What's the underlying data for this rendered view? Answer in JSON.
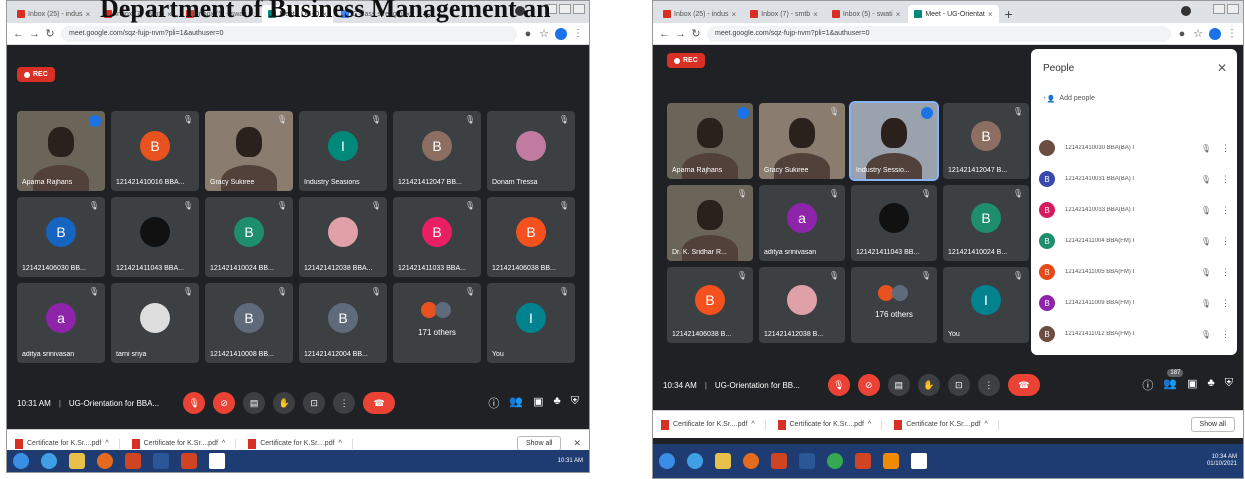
{
  "heading": "Department of Business Management an",
  "left": {
    "tabs": [
      {
        "label": "Inbox (25) - indus",
        "active": false,
        "kind": "gmail"
      },
      {
        "label": "Inbox (7) - smtb",
        "active": false,
        "kind": "gmail"
      },
      {
        "label": "Inbox (5) - swati",
        "active": false,
        "kind": "gmail"
      },
      {
        "label": "Meet - UG-O",
        "active": true,
        "kind": "meet"
      },
      {
        "label": "G class strength",
        "active": false,
        "kind": "gmail"
      }
    ],
    "url": "meet.google.com/sqz-fujp-nvm?pli=1&authuser=0",
    "rec_label": "REC",
    "tiles": [
      {
        "name": "Aparna Rajhans",
        "type": "photo",
        "initial": "",
        "color": "",
        "speaking": true
      },
      {
        "name": "121421410016 BBA...",
        "type": "initial",
        "initial": "B",
        "color": "#e8521f"
      },
      {
        "name": "Gracy Sukiree",
        "type": "photo2",
        "initial": "",
        "color": ""
      },
      {
        "name": "Industry Seasions",
        "type": "initial",
        "initial": "I",
        "color": "#00897b"
      },
      {
        "name": "121421412047 BB...",
        "type": "initial",
        "initial": "B",
        "color": "#8d6e63"
      },
      {
        "name": "Donam Tressa",
        "type": "pic",
        "initial": "",
        "color": "#c27ba0"
      },
      {
        "name": "121421406030 BB...",
        "type": "initial",
        "initial": "B",
        "color": "#1565c0"
      },
      {
        "name": "121421411043 BBA...",
        "type": "initial",
        "initial": "",
        "color": "#111111"
      },
      {
        "name": "121421410024 BB...",
        "type": "initial",
        "initial": "B",
        "color": "#1e8e6e"
      },
      {
        "name": "121421412038 BBA...",
        "type": "pic",
        "initial": "",
        "color": "#e0a0a8"
      },
      {
        "name": "121421411033 BBA...",
        "type": "initial",
        "initial": "B",
        "color": "#e91e63"
      },
      {
        "name": "121421406038 BB...",
        "type": "initial",
        "initial": "B",
        "color": "#f4511e"
      },
      {
        "name": "aditya srinivasan",
        "type": "initial",
        "initial": "a",
        "color": "#8e24aa"
      },
      {
        "name": "tarni sriya",
        "type": "pic",
        "initial": "",
        "color": "#dddddd"
      },
      {
        "name": "121421410008 BB...",
        "type": "initial",
        "initial": "B",
        "color": "#5f6b7a"
      },
      {
        "name": "121421412004 BB...",
        "type": "initial",
        "initial": "B",
        "color": "#5f6b7a"
      },
      {
        "name": "171 others",
        "type": "others",
        "initial": "",
        "color": ""
      },
      {
        "name": "You",
        "type": "initial",
        "initial": "I",
        "color": "#00838f"
      }
    ],
    "time": "10:31 AM",
    "meeting": "UG-Orientation for BBA...",
    "downloads": [
      "Certificate for K.Sr....pdf",
      "Certificate for K.Sr....pdf",
      "Certificate for K.Sr....pdf"
    ],
    "show_all": "Show all",
    "clock_time": "10:31 AM"
  },
  "right": {
    "tabs": [
      {
        "label": "Inbox (25) - indus",
        "active": false,
        "kind": "gmail"
      },
      {
        "label": "Inbox (7) - smtb",
        "active": false,
        "kind": "gmail"
      },
      {
        "label": "Inbox (5) - swati",
        "active": false,
        "kind": "gmail"
      },
      {
        "label": "Meet - UG-Orientat",
        "active": true,
        "kind": "meet"
      }
    ],
    "url": "meet.google.com/sqz-fujp-nvm?pli=1&authuser=0",
    "rec_label": "REC",
    "tiles": [
      {
        "name": "Aparna Rajhans",
        "type": "photo",
        "initial": "",
        "color": "",
        "speaking": true
      },
      {
        "name": "Gracy Sukiree",
        "type": "photo2",
        "initial": "",
        "color": ""
      },
      {
        "name": "Industry Sessio...",
        "type": "photo3",
        "initial": "",
        "color": "",
        "active": true,
        "speaking": true
      },
      {
        "name": "121421412047 B...",
        "type": "initial",
        "initial": "B",
        "color": "#8d6e63"
      },
      {
        "name": "Dr. K. Sridhar R...",
        "type": "photo",
        "initial": "",
        "color": ""
      },
      {
        "name": "aditya srinivasan",
        "type": "initial",
        "initial": "a",
        "color": "#8e24aa"
      },
      {
        "name": "121421411043 BB...",
        "type": "initial",
        "initial": "",
        "color": "#111111"
      },
      {
        "name": "121421410024 B...",
        "type": "initial",
        "initial": "B",
        "color": "#1e8e6e"
      },
      {
        "name": "121421406038 B...",
        "type": "initial",
        "initial": "B",
        "color": "#f4511e"
      },
      {
        "name": "121421412038 B...",
        "type": "pic",
        "initial": "",
        "color": "#e0a0a8"
      },
      {
        "name": "176 others",
        "type": "others",
        "initial": "",
        "color": ""
      },
      {
        "name": "You",
        "type": "initial",
        "initial": "I",
        "color": "#00838f"
      }
    ],
    "people": {
      "title": "People",
      "add_label": "Add people",
      "rows": [
        {
          "name": "121421410030 BBA(BA) I",
          "initial": "",
          "color": "#6d4c41"
        },
        {
          "name": "121421410031 BBA(BA) I",
          "initial": "B",
          "color": "#3949ab"
        },
        {
          "name": "121421410033 BBA(BA) I",
          "initial": "B",
          "color": "#d81b60"
        },
        {
          "name": "121421411004 BBA(FM) I",
          "initial": "B",
          "color": "#1e8e6e"
        },
        {
          "name": "121421411005 BBA(FM) I",
          "initial": "B",
          "color": "#e64a19"
        },
        {
          "name": "121421411009 BBA(FM) I",
          "initial": "B",
          "color": "#8e24aa"
        },
        {
          "name": "121421411012 BBA(FM) I",
          "initial": "B",
          "color": "#6d4c41"
        }
      ]
    },
    "time": "10:34 AM",
    "meeting": "UG-Orientation for BB...",
    "participant_badge": "187",
    "downloads": [
      "Certificate for K.Sr....pdf",
      "Certificate for K.Sr....pdf",
      "Certificate for K.Sr....pdf"
    ],
    "show_all": "Show all",
    "clock_time": "10:34 AM",
    "clock_date": "01/10/2021"
  }
}
